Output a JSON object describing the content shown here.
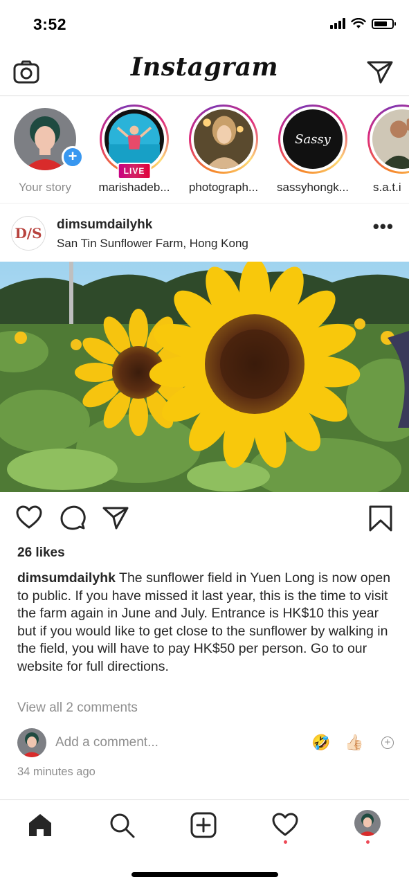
{
  "status_bar": {
    "time": "3:52",
    "battery_level": 0.75
  },
  "header": {
    "app_title": "Instagram"
  },
  "stories": [
    {
      "label": "Your story",
      "own": true
    },
    {
      "label": "marishadeb...",
      "badge": "LIVE"
    },
    {
      "label": "photograph..."
    },
    {
      "label": "sassyhongk...",
      "avatar_text": "Sassy"
    },
    {
      "label": "s.a.t.i"
    }
  ],
  "post": {
    "username": "dimsumdailyhk",
    "avatar_text": "D/S",
    "location": "San Tin Sunflower Farm, Hong Kong",
    "more": "•••",
    "likes": "26 likes",
    "caption_user": "dimsumdailyhk",
    "caption_text": "The sunflower field in Yuen Long is now open to public. If you have missed it last year, this is the time to visit the farm again in June and July. Entrance is HK$10 this year but if you would like to get close to the sunflower by walking in the field, you will have to pay HK$50 per person. Go to our website for full directions.",
    "view_comments": "View all 2 comments",
    "comment_placeholder": "Add a comment...",
    "quick_emojis": [
      "🤣",
      "👍🏻"
    ],
    "time_ago": "34 minutes ago"
  },
  "icons": {
    "top": [
      "camera-icon",
      "direct-send-icon"
    ],
    "actions": [
      "heart-icon",
      "comment-icon",
      "share-icon",
      "bookmark-icon"
    ],
    "bottom_nav": [
      "home-icon",
      "search-icon",
      "new-post-icon",
      "activity-heart-icon",
      "profile-avatar"
    ]
  },
  "colors": {
    "accent_blue": "#3897f0",
    "notification_red": "#ed4956",
    "live_red": "#e10038",
    "muted_text": "#8e8e8e"
  }
}
